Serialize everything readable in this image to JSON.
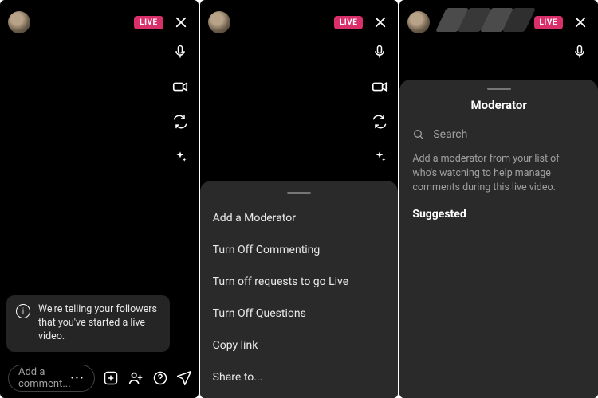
{
  "common": {
    "live": "LIVE",
    "comment_placeholder": "Add a comment...",
    "rail": [
      "mic-icon",
      "camera-icon",
      "flip-icon",
      "sparkle-icon"
    ],
    "botbar": [
      "add-media-icon",
      "add-guest-icon",
      "question-icon",
      "share-icon"
    ]
  },
  "panel1": {
    "toast": "We're telling your followers that you've started a live video."
  },
  "panel2": {
    "sheet": [
      "Add a Moderator",
      "Turn Off Commenting",
      "Turn off requests to go Live",
      "Turn Off Questions",
      "Copy link",
      "Share to..."
    ]
  },
  "panel3": {
    "title": "Moderator",
    "search_placeholder": "Search",
    "help": "Add a moderator from your list of who's watching to help manage comments during this live video.",
    "suggested": "Suggested"
  }
}
